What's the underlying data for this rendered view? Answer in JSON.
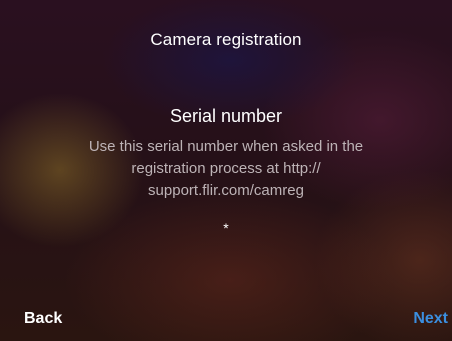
{
  "screen": {
    "title": "Camera registration",
    "heading": "Serial number",
    "description": "Use this serial number when asked in the registration process at http:// support.flir.com/camreg",
    "serial_value": "*"
  },
  "nav": {
    "back_label": "Back",
    "next_label": "Next"
  },
  "colors": {
    "text": "#ffffff",
    "description_text": "#bdb3b6",
    "accent": "#3b8fe0"
  }
}
